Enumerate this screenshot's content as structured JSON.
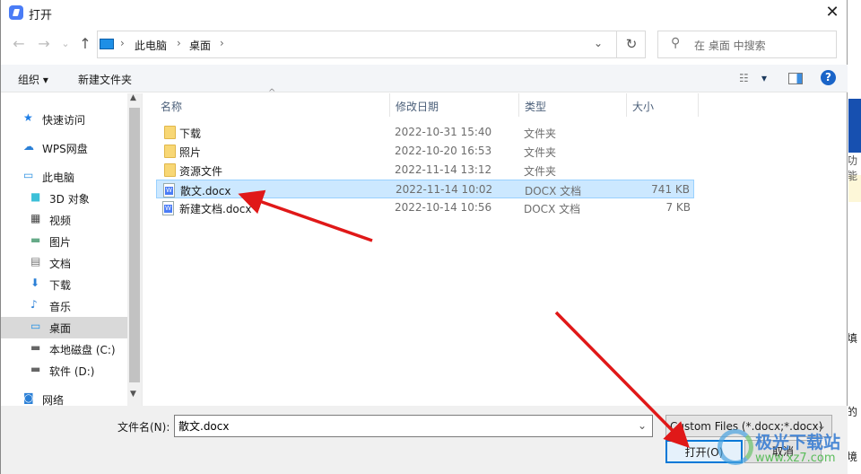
{
  "window": {
    "title": "打开",
    "close_icon": "close-icon"
  },
  "nav": {
    "back": "←",
    "forward": "→",
    "recent": "⌄",
    "up": "↑"
  },
  "address": {
    "crumbs": [
      "此电脑",
      "桌面"
    ],
    "refresh": "↻"
  },
  "search": {
    "placeholder": "在 桌面 中搜索"
  },
  "toolbar": {
    "organize": "组织 ▾",
    "new_folder": "新建文件夹",
    "view_label": "▾",
    "help": "?"
  },
  "sidebar": {
    "items": [
      {
        "label": "快速访问",
        "icon": "star-icon"
      },
      {
        "label": "WPS网盘",
        "icon": "cloud-icon"
      },
      {
        "label": "此电脑",
        "icon": "computer-icon"
      },
      {
        "label": "3D 对象",
        "icon": "cube-icon"
      },
      {
        "label": "视频",
        "icon": "video-icon"
      },
      {
        "label": "图片",
        "icon": "picture-icon"
      },
      {
        "label": "文档",
        "icon": "document-icon"
      },
      {
        "label": "下载",
        "icon": "download-icon"
      },
      {
        "label": "音乐",
        "icon": "music-icon"
      },
      {
        "label": "桌面",
        "icon": "desktop-icon",
        "selected": true
      },
      {
        "label": "本地磁盘 (C:)",
        "icon": "drive-icon"
      },
      {
        "label": "软件 (D:)",
        "icon": "drive-icon"
      },
      {
        "label": "网络",
        "icon": "network-icon"
      }
    ]
  },
  "columns": [
    "名称",
    "修改日期",
    "类型",
    "大小"
  ],
  "files": [
    {
      "name": "下载",
      "date": "2022-10-31 15:40",
      "type": "文件夹",
      "size": "",
      "kind": "folder"
    },
    {
      "name": "照片",
      "date": "2022-10-20 16:53",
      "type": "文件夹",
      "size": "",
      "kind": "folder"
    },
    {
      "name": "资源文件",
      "date": "2022-11-14 13:12",
      "type": "文件夹",
      "size": "",
      "kind": "folder"
    },
    {
      "name": "散文.docx",
      "date": "2022-11-14 10:02",
      "type": "DOCX 文档",
      "size": "741 KB",
      "kind": "doc",
      "selected": true
    },
    {
      "name": "新建文档.docx",
      "date": "2022-10-14 10:56",
      "type": "DOCX 文档",
      "size": "7 KB",
      "kind": "doc"
    }
  ],
  "footer": {
    "filename_label": "文件名(N):",
    "filename_value": "散文.docx",
    "filter": "Custom Files (*.docx;*.docx)",
    "open": "打开(O)",
    "cancel": "取消"
  },
  "background_app": {
    "texts": [
      "功能",
      "填",
      "的",
      "境"
    ],
    "accent": "#1750b0"
  },
  "watermark": {
    "name": "极光下载站",
    "url": "www.xz7.com"
  },
  "colors": {
    "selection": "#cce8ff",
    "arrow": "#e01818",
    "accent": "#0078d7"
  }
}
